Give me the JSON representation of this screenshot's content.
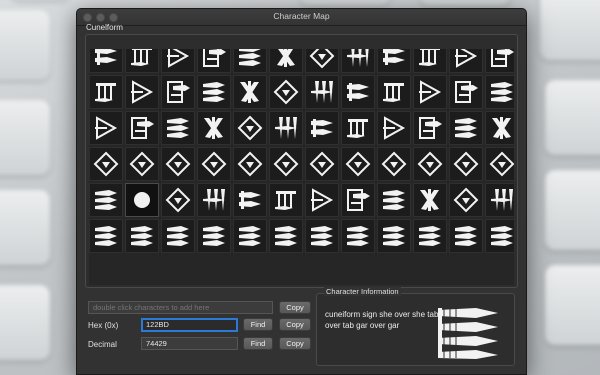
{
  "window": {
    "title": "Character Map"
  },
  "block": {
    "name": "Cunelform"
  },
  "add_field": {
    "placeholder": "double click characters to add here",
    "copy_label": "Copy"
  },
  "hex": {
    "label": "Hex (0x)",
    "value": "122BD",
    "find_label": "Find",
    "copy_label": "Copy"
  },
  "decimal": {
    "label": "Decimal",
    "value": "74429",
    "find_label": "Find",
    "copy_label": "Copy"
  },
  "info": {
    "title": "Character Information",
    "description": "cuneiform sign she over she tab over tab gar over gar",
    "glyph_icon": "cuneiform-she-over-she-glyph"
  },
  "grid": {
    "rows": 6,
    "columns": 12,
    "selected_index": 49
  },
  "colors": {
    "accent": "#2d7ad6",
    "window_bg": "#323232",
    "cell_bg": "#1c1c1c",
    "glyph": "#f2f2f2"
  }
}
